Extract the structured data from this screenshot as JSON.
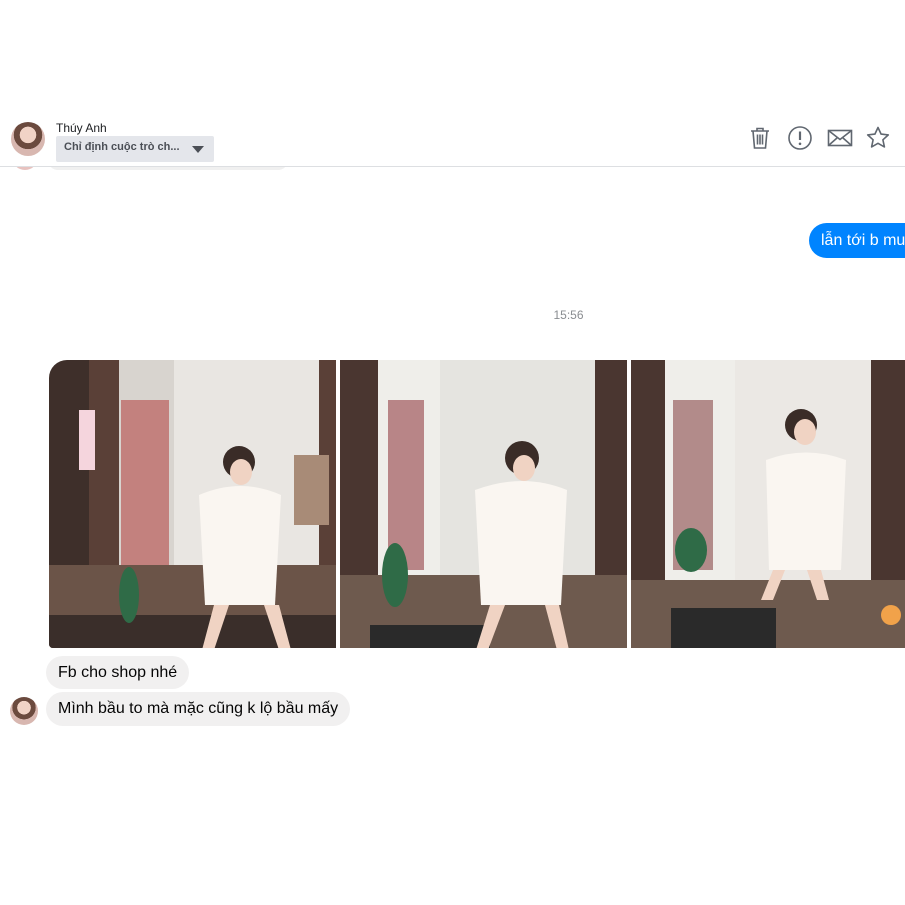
{
  "header": {
    "contact_name": "Thúy Anh",
    "conversation_select": "Chỉ định cuộc trò ch...",
    "icons": [
      "trash-icon",
      "report-icon",
      "mail-icon",
      "star-icon"
    ]
  },
  "messages": {
    "outgoing": "lẫn tới b mu",
    "timestamp": "15:56",
    "photos": [
      {
        "icon": "photo",
        "alt": "mirror selfie photo 1"
      },
      {
        "icon": "photo",
        "alt": "mirror selfie photo 2"
      },
      {
        "icon": "photo",
        "alt": "mirror selfie photo 3"
      }
    ],
    "incoming": [
      "Fb cho shop nhé",
      "Mình bầu to mà mặc cũng k lộ bầu mấy"
    ]
  },
  "colors": {
    "outgoing_bubble": "#0084ff",
    "incoming_bubble": "#f1f0f0",
    "header_border": "#dddfe2"
  }
}
